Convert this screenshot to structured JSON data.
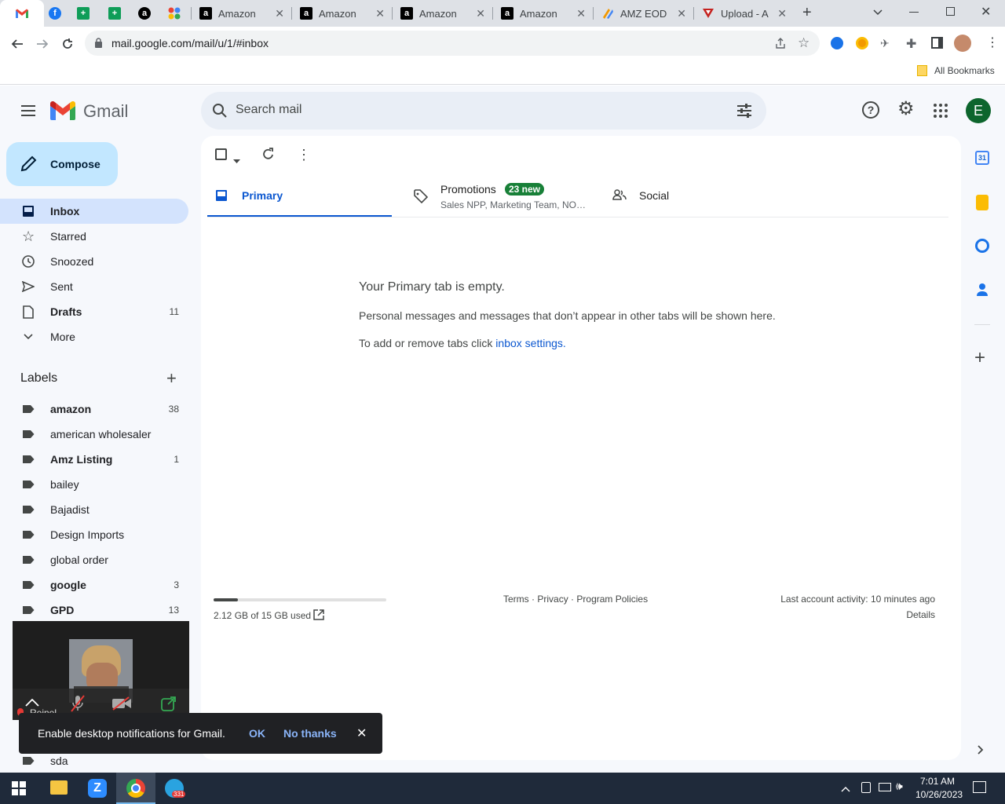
{
  "browser": {
    "tabs": [
      {
        "label": "Amazon"
      },
      {
        "label": "Amazon"
      },
      {
        "label": "Amazon"
      },
      {
        "label": "Amazon"
      },
      {
        "label": "AMZ EOD R"
      },
      {
        "label": "Upload - A"
      }
    ],
    "url": "mail.google.com/mail/u/1/#inbox",
    "bookmarks_label": "All Bookmarks"
  },
  "gmail": {
    "brand": "Gmail",
    "search_placeholder": "Search mail",
    "avatar_letter": "E",
    "compose_label": "Compose",
    "nav": [
      {
        "label": "Inbox",
        "count": ""
      },
      {
        "label": "Starred",
        "count": ""
      },
      {
        "label": "Snoozed",
        "count": ""
      },
      {
        "label": "Sent",
        "count": ""
      },
      {
        "label": "Drafts",
        "count": "11"
      },
      {
        "label": "More",
        "count": ""
      }
    ],
    "labels_heading": "Labels",
    "labels": [
      {
        "label": "amazon",
        "count": "38"
      },
      {
        "label": "american wholesaler",
        "count": ""
      },
      {
        "label": "Amz Listing",
        "count": "1"
      },
      {
        "label": "bailey",
        "count": ""
      },
      {
        "label": "Bajadist",
        "count": ""
      },
      {
        "label": "Design Imports",
        "count": ""
      },
      {
        "label": "global order",
        "count": ""
      },
      {
        "label": "google",
        "count": "3"
      },
      {
        "label": "GPD",
        "count": "13"
      },
      {
        "label": "sda",
        "count": ""
      }
    ],
    "tabs": {
      "primary": "Primary",
      "promotions": "Promotions",
      "promotions_badge": "23 new",
      "promotions_sub": "Sales NPP, Marketing Team, NO…",
      "social": "Social"
    },
    "empty": {
      "title": "Your Primary tab is empty.",
      "line1": "Personal messages and messages that don’t appear in other tabs will be shown here.",
      "line2_prefix": "To add or remove tabs click ",
      "line2_link": "inbox settings."
    },
    "footer": {
      "storage": "2.12 GB of 15 GB used",
      "storage_fraction": 0.14,
      "terms": "Terms",
      "privacy": "Privacy",
      "policies": "Program Policies",
      "sep": "·",
      "activity": "Last account activity: 10 minutes ago",
      "details": "Details"
    },
    "snackbar": {
      "text": "Enable desktop notifications for Gmail.",
      "ok": "OK",
      "no": "No thanks"
    }
  },
  "video": {
    "name": "Reinel"
  },
  "taskbar": {
    "time": "7:01 AM",
    "date": "10/26/2023",
    "badge": "331"
  },
  "colors": {
    "accent": "#0b57d0",
    "selected_nav": "#d3e3fd",
    "compose": "#c2e7ff",
    "badge_green": "#188038",
    "avatar": "#0d652d"
  }
}
